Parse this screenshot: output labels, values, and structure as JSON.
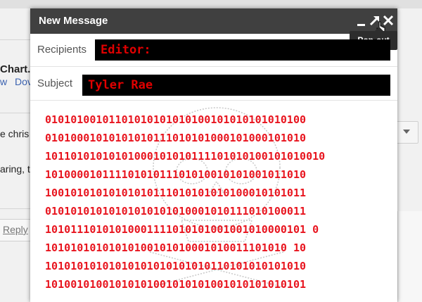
{
  "background": {
    "fragment_chart": "Chart.p",
    "fragment_w": "w",
    "fragment_dov": "Dov",
    "fragment_e_chris": "e chris",
    "fragment_aring": "aring, t",
    "fragment_reply": "Reply"
  },
  "compose": {
    "title": "New Message",
    "tooltip": "Pop-out",
    "recipients_label": "Recipients",
    "recipients_value": "Editor:",
    "subject_label": "Subject",
    "subject_value": "Tyler Rae",
    "body_lines": [
      "01010100101101010101010100101010101010100",
      "01010001010101010111010101000101000101010",
      "10110101010101000101010111101010100101010010",
      "10100001011110101011101010010101001011010",
      "10010101010101010111010101010100010101011",
      "01010101010101010101010001010111010100011",
      "10101110101010001111010101001001010000101 0",
      "10101010101010100101010001010011101010 10",
      "10101010101010101010101010110101010101010",
      "10100101001010101001010101001010101010101"
    ]
  },
  "colors": {
    "titlebar": "#404040",
    "binary_red": "#e8141e",
    "redaction": "#000000"
  }
}
